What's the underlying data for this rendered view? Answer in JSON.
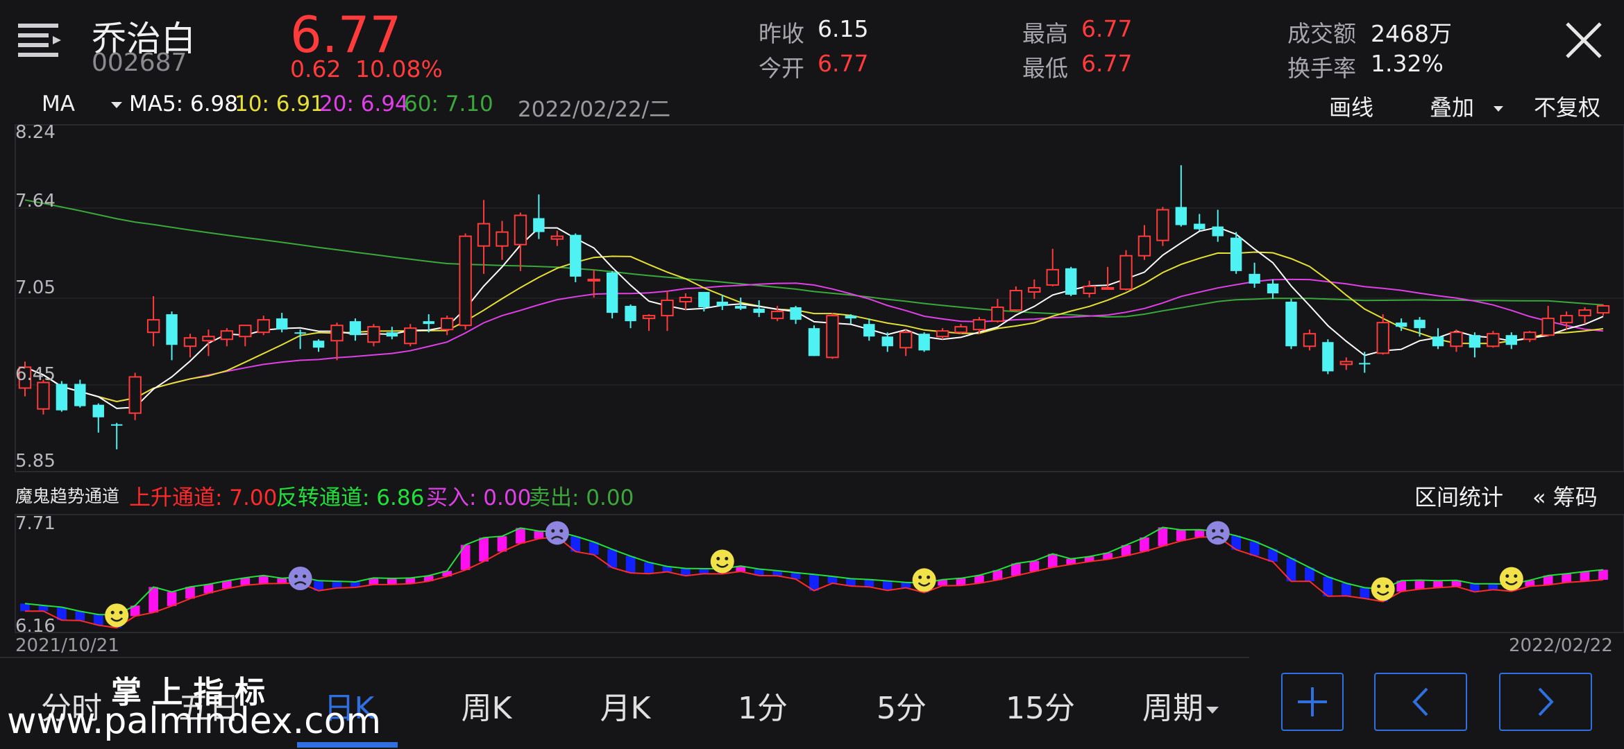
{
  "header": {
    "stock_name": "乔治白",
    "stock_code": "002687",
    "price": "6.77",
    "change": "0.62",
    "change_pct": "10.08%",
    "prev_close_label": "昨收",
    "prev_close": "6.15",
    "open_label": "今开",
    "open": "6.77",
    "high_label": "最高",
    "high": "6.77",
    "low_label": "最低",
    "low": "6.77",
    "turnover_label": "成交额",
    "turnover": "2468万",
    "turnover_rate_label": "换手率",
    "turnover_rate": "1.32%"
  },
  "ma_bar": {
    "indicator": "MA",
    "ma5": "MA5: 6.98",
    "ma10": "10: 6.91",
    "ma20": "20: 6.94",
    "ma60": "60: 7.10",
    "date": "2022/02/22/二",
    "draw_label": "画线",
    "overlay_label": "叠加",
    "adjust_label": "不复权"
  },
  "price_axis": [
    "8.24",
    "7.64",
    "7.05",
    "6.45",
    "5.85"
  ],
  "indicator_bar": {
    "name": "魔鬼趋势通道",
    "up": "上升通道: 7.00",
    "rev": "反转通道: 6.86",
    "buy": "买入: 0.00",
    "sell": "卖出: 0.00",
    "range_stats": "区间统计",
    "chips": "« 筹码"
  },
  "sub_axis": [
    "7.71",
    "6.16"
  ],
  "dates": {
    "start": "2021/10/21",
    "end": "2022/02/22"
  },
  "tabs": [
    "分时",
    "五日",
    "日K",
    "周K",
    "月K",
    "1分",
    "5分",
    "15分",
    "周期"
  ],
  "active_tab": "日K",
  "watermark": {
    "title": "掌 上 指 标",
    "url": "www.palmindex.com"
  },
  "colors": {
    "up": "#ff3b3b",
    "down": "#4ef2f2",
    "ma5": "#ffffff",
    "ma10": "#e6e035",
    "ma20": "#e040e8",
    "ma60": "#3aa83a",
    "accent": "#2f6fe0"
  },
  "chart_data": {
    "type": "candlestick",
    "y_range": [
      5.85,
      8.24
    ],
    "candles": [
      [
        6.4,
        6.55,
        6.59,
        6.34
      ],
      [
        6.25,
        6.44,
        6.46,
        6.21
      ],
      [
        6.43,
        6.24,
        6.45,
        6.23
      ],
      [
        6.43,
        6.27,
        6.46,
        6.26
      ],
      [
        6.28,
        6.19,
        6.29,
        6.08
      ],
      [
        6.14,
        6.13,
        6.15,
        5.96
      ],
      [
        6.22,
        6.48,
        6.51,
        6.17
      ],
      [
        6.8,
        6.89,
        7.06,
        6.7
      ],
      [
        6.93,
        6.71,
        6.95,
        6.6
      ],
      [
        6.7,
        6.76,
        6.79,
        6.62
      ],
      [
        6.74,
        6.77,
        6.82,
        6.63
      ],
      [
        6.75,
        6.81,
        6.83,
        6.7
      ],
      [
        6.77,
        6.85,
        6.85,
        6.7
      ],
      [
        6.8,
        6.89,
        6.92,
        6.78
      ],
      [
        6.9,
        6.82,
        6.94,
        6.8
      ],
      [
        6.8,
        6.79,
        6.82,
        6.68
      ],
      [
        6.74,
        6.69,
        6.75,
        6.66
      ],
      [
        6.74,
        6.85,
        6.87,
        6.6
      ],
      [
        6.88,
        6.78,
        6.9,
        6.74
      ],
      [
        6.73,
        6.84,
        6.86,
        6.7
      ],
      [
        6.8,
        6.77,
        6.84,
        6.75
      ],
      [
        6.72,
        6.83,
        6.86,
        6.7
      ],
      [
        6.88,
        6.86,
        6.93,
        6.8
      ],
      [
        6.82,
        6.9,
        6.92,
        6.78
      ],
      [
        6.85,
        7.49,
        7.51,
        6.82
      ],
      [
        7.42,
        7.58,
        7.75,
        7.22
      ],
      [
        7.42,
        7.52,
        7.6,
        7.32
      ],
      [
        7.43,
        7.64,
        7.66,
        7.24
      ],
      [
        7.62,
        7.52,
        7.79,
        7.47
      ],
      [
        7.47,
        7.49,
        7.53,
        7.42
      ],
      [
        7.5,
        7.2,
        7.51,
        7.16
      ],
      [
        7.17,
        7.18,
        7.25,
        7.05
      ],
      [
        7.23,
        6.94,
        7.24,
        6.9
      ],
      [
        6.99,
        6.88,
        7.0,
        6.83
      ],
      [
        6.9,
        6.92,
        6.93,
        6.81
      ],
      [
        6.92,
        7.03,
        7.1,
        6.81
      ],
      [
        7.02,
        7.05,
        7.08,
        6.96
      ],
      [
        7.09,
        6.98,
        7.09,
        6.95
      ],
      [
        7.02,
        6.99,
        7.07,
        6.96
      ],
      [
        6.99,
        6.97,
        7.05,
        6.96
      ],
      [
        6.97,
        6.94,
        7.03,
        6.91
      ],
      [
        6.9,
        6.95,
        6.99,
        6.88
      ],
      [
        6.98,
        6.89,
        6.99,
        6.86
      ],
      [
        6.83,
        6.63,
        6.85,
        6.63
      ],
      [
        6.62,
        6.92,
        6.94,
        6.61
      ],
      [
        6.92,
        6.9,
        6.93,
        6.86
      ],
      [
        6.86,
        6.77,
        6.9,
        6.74
      ],
      [
        6.77,
        6.7,
        6.8,
        6.66
      ],
      [
        6.69,
        6.8,
        6.82,
        6.63
      ],
      [
        6.79,
        6.67,
        6.8,
        6.66
      ],
      [
        6.77,
        6.81,
        6.83,
        6.75
      ],
      [
        6.8,
        6.84,
        6.86,
        6.79
      ],
      [
        6.82,
        6.89,
        6.91,
        6.79
      ],
      [
        6.88,
        6.98,
        7.04,
        6.87
      ],
      [
        6.96,
        7.1,
        7.13,
        6.95
      ],
      [
        7.09,
        7.12,
        7.18,
        7.04
      ],
      [
        7.14,
        7.25,
        7.4,
        7.13
      ],
      [
        7.26,
        7.07,
        7.27,
        7.06
      ],
      [
        7.08,
        7.13,
        7.17,
        7.05
      ],
      [
        7.12,
        7.12,
        7.27,
        7.11
      ],
      [
        7.11,
        7.35,
        7.39,
        7.1
      ],
      [
        7.35,
        7.49,
        7.57,
        7.32
      ],
      [
        7.46,
        7.68,
        7.7,
        7.42
      ],
      [
        7.7,
        7.57,
        8.0,
        7.56
      ],
      [
        7.58,
        7.54,
        7.65,
        7.53
      ],
      [
        7.56,
        7.49,
        7.68,
        7.45
      ],
      [
        7.48,
        7.24,
        7.52,
        7.22
      ],
      [
        7.22,
        7.15,
        7.3,
        7.12
      ],
      [
        7.15,
        7.08,
        7.18,
        7.04
      ],
      [
        7.02,
        6.7,
        7.04,
        6.68
      ],
      [
        6.7,
        6.79,
        6.82,
        6.67
      ],
      [
        6.73,
        6.52,
        6.75,
        6.5
      ],
      [
        6.57,
        6.59,
        6.62,
        6.53
      ],
      [
        6.58,
        6.57,
        6.66,
        6.51
      ],
      [
        6.65,
        6.87,
        6.93,
        6.64
      ],
      [
        6.87,
        6.84,
        6.9,
        6.81
      ],
      [
        6.89,
        6.83,
        6.91,
        6.77
      ],
      [
        6.77,
        6.7,
        6.83,
        6.68
      ],
      [
        6.7,
        6.8,
        6.82,
        6.66
      ],
      [
        6.78,
        6.69,
        6.8,
        6.62
      ],
      [
        6.7,
        6.79,
        6.81,
        6.69
      ],
      [
        6.78,
        6.71,
        6.8,
        6.68
      ],
      [
        6.75,
        6.8,
        6.81,
        6.73
      ],
      [
        6.78,
        6.9,
        6.99,
        6.77
      ],
      [
        6.87,
        6.92,
        6.95,
        6.82
      ],
      [
        6.92,
        6.96,
        6.98,
        6.86
      ],
      [
        6.94,
        6.99,
        7.0,
        6.92
      ]
    ]
  }
}
